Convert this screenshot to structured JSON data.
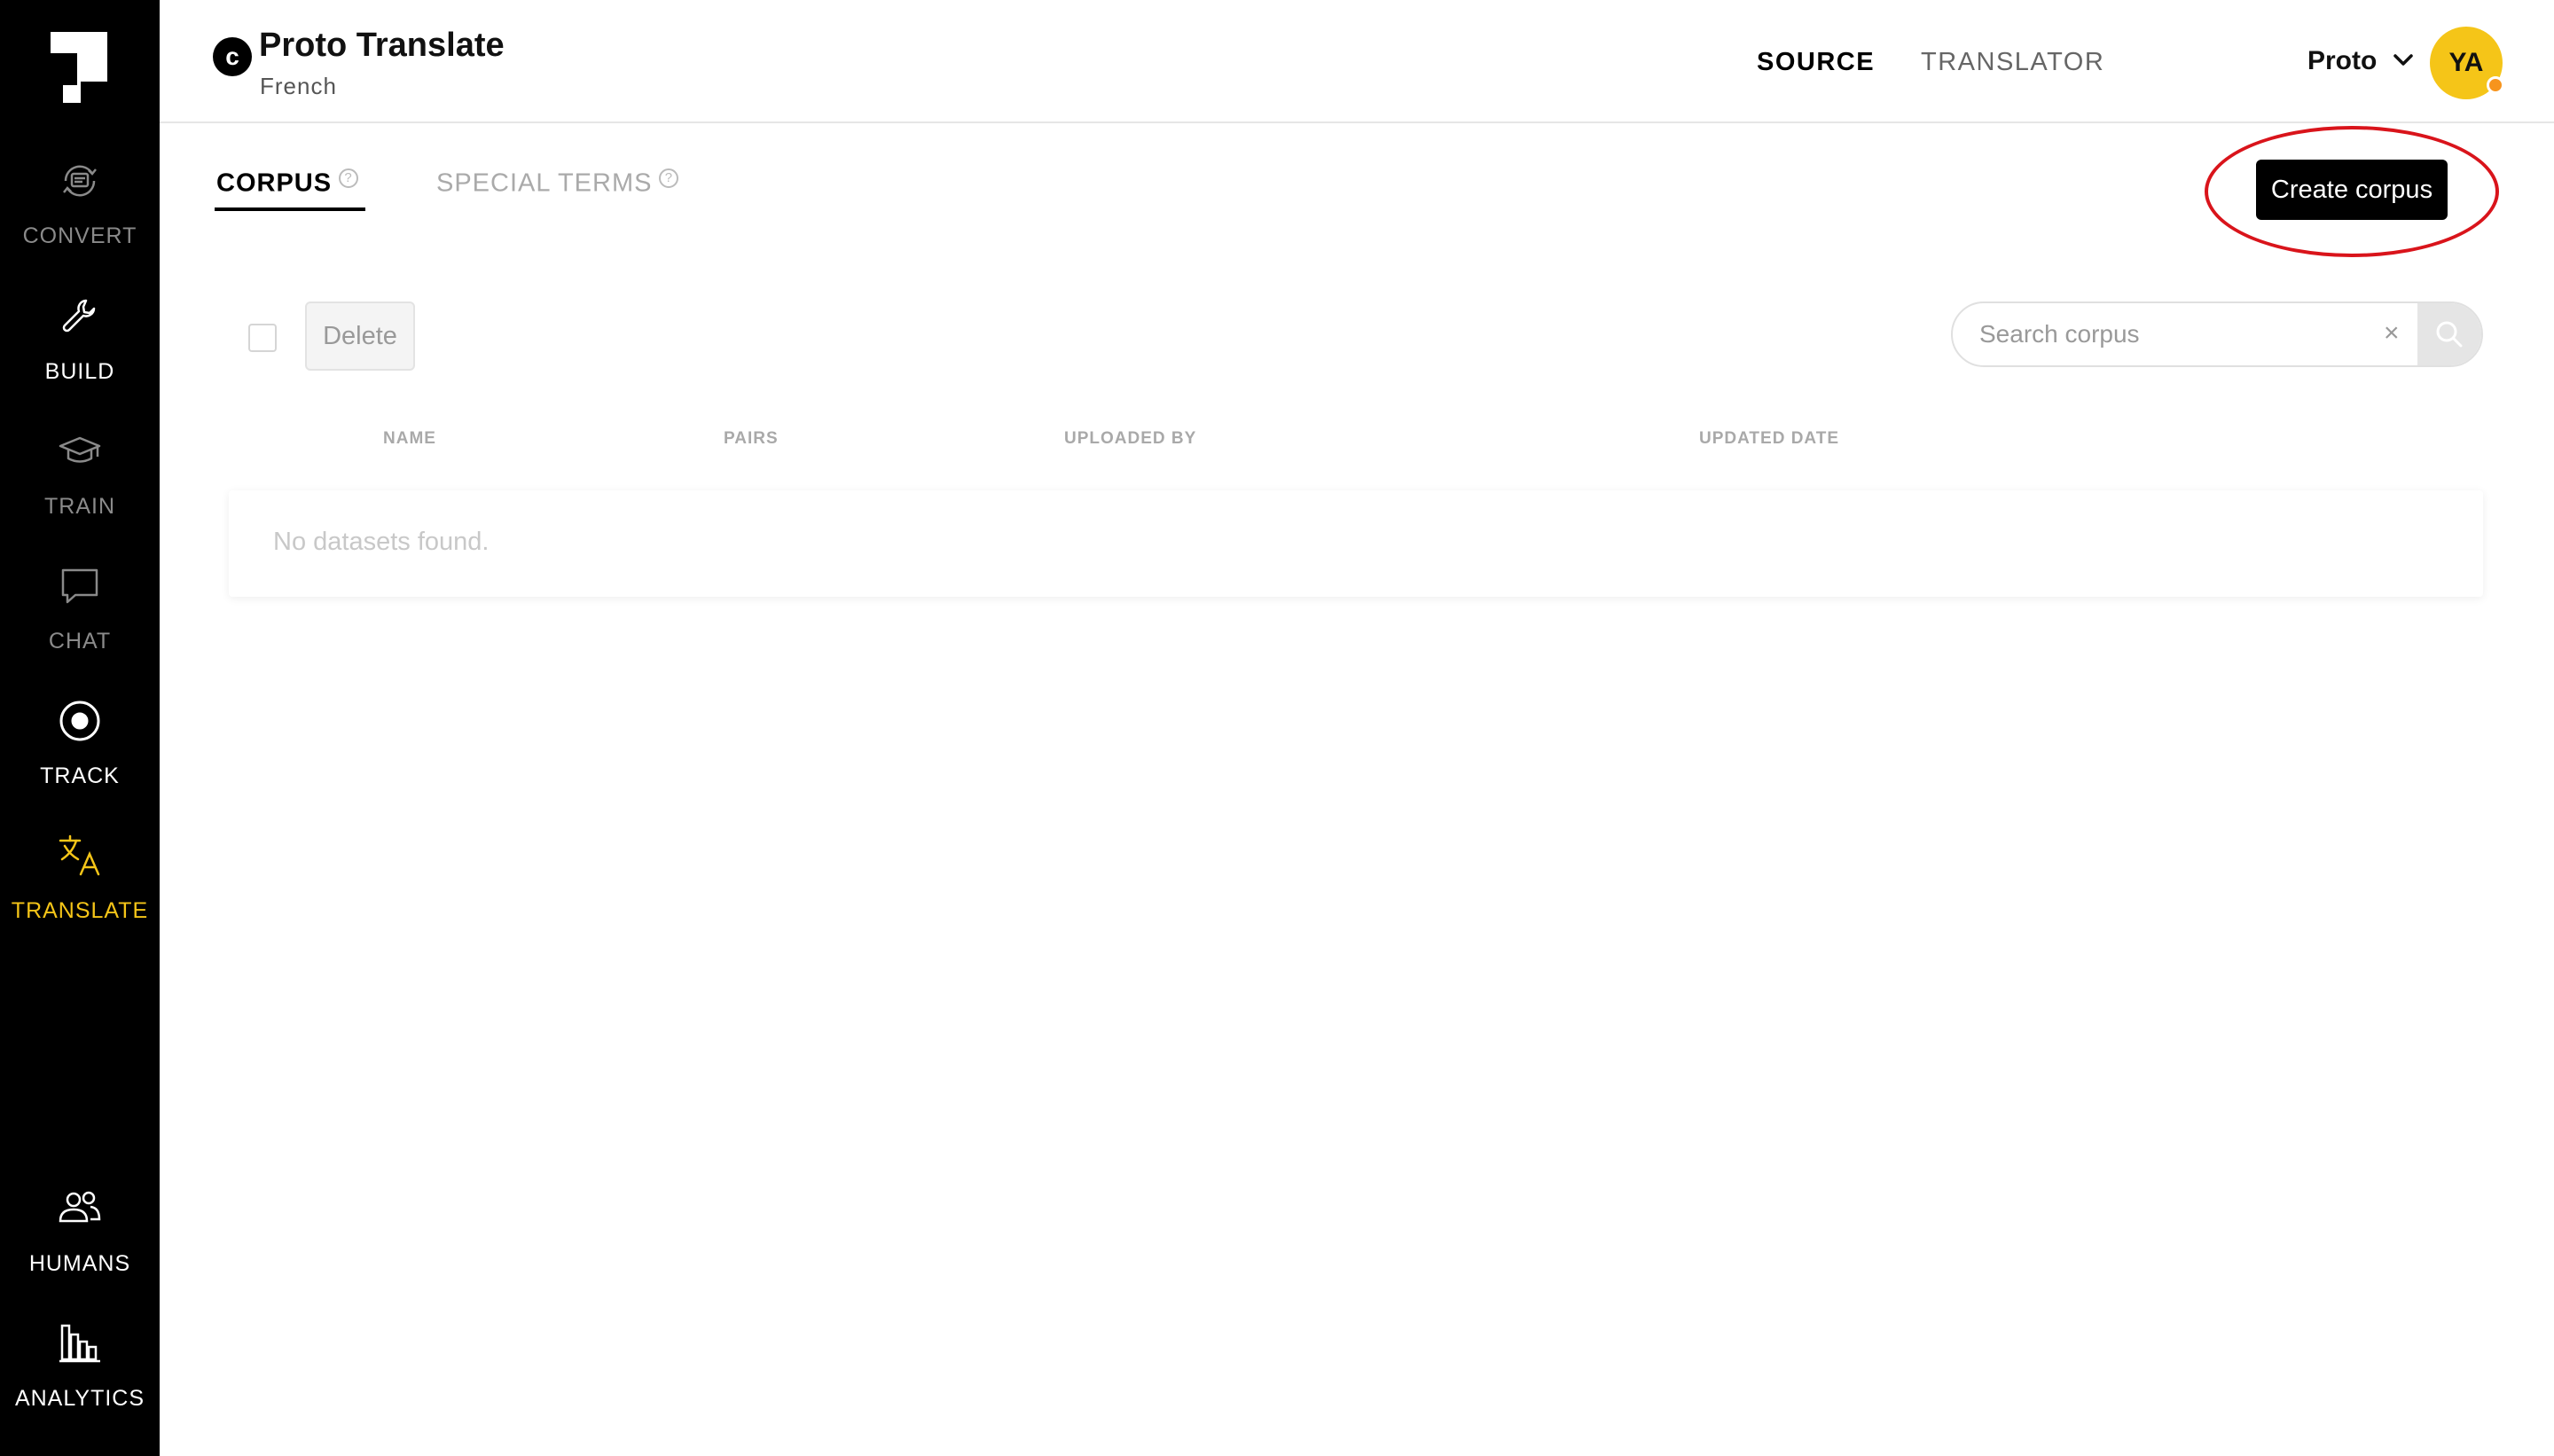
{
  "sidebar": {
    "items": [
      {
        "label": "CONVERT",
        "icon": "convert-icon",
        "state": "disabled"
      },
      {
        "label": "BUILD",
        "icon": "wrench-icon",
        "state": "normal"
      },
      {
        "label": "TRAIN",
        "icon": "graduation-cap-icon",
        "state": "disabled"
      },
      {
        "label": "CHAT",
        "icon": "chat-bubble-icon",
        "state": "disabled"
      },
      {
        "label": "TRACK",
        "icon": "target-icon",
        "state": "normal"
      },
      {
        "label": "TRANSLATE",
        "icon": "translate-icon",
        "state": "active"
      },
      {
        "label": "HUMANS",
        "icon": "users-icon",
        "state": "normal"
      },
      {
        "label": "ANALYTICS",
        "icon": "bar-chart-icon",
        "state": "normal"
      }
    ]
  },
  "header": {
    "project_title": "Proto Translate",
    "project_language": "French",
    "tabs": [
      {
        "label": "SOURCE",
        "active": true
      },
      {
        "label": "TRANSLATOR",
        "active": false
      }
    ],
    "org_name": "Proto",
    "avatar_initials": "YA"
  },
  "subtabs": [
    {
      "label": "CORPUS",
      "active": true
    },
    {
      "label": "SPECIAL TERMS",
      "active": false
    }
  ],
  "help_glyph": "?",
  "create_button_label": "Create corpus",
  "toolbar": {
    "delete_label": "Delete",
    "search_placeholder": "Search corpus",
    "clear_glyph": "×"
  },
  "table": {
    "columns": [
      "NAME",
      "PAIRS",
      "UPLOADED BY",
      "UPDATED DATE"
    ],
    "empty_message": "No datasets found."
  },
  "colors": {
    "sidebar_bg": "#000000",
    "active_accent": "#f5c518",
    "nav_normal": "#ffffff",
    "nav_disabled": "#8a8a8a",
    "highlight_ring": "#d9141b",
    "avatar_status": "#f7941d"
  }
}
